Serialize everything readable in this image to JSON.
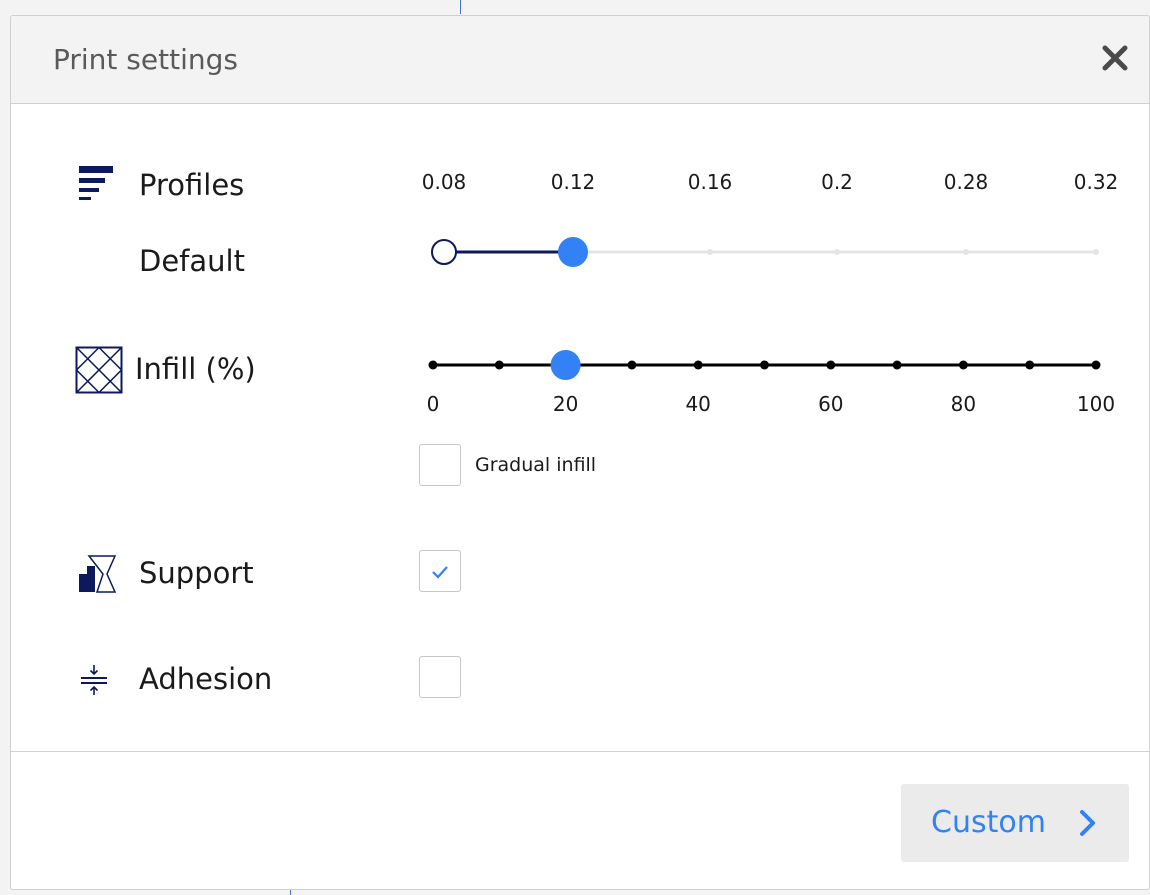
{
  "panel": {
    "title": "Print settings",
    "close_glyph": "✕"
  },
  "profiles": {
    "label": "Profiles",
    "current_profile": "Default",
    "icon": "profiles-icon",
    "layer_heights": [
      "0.08",
      "0.12",
      "0.16",
      "0.2",
      "0.28",
      "0.32"
    ],
    "selected_index": 1,
    "min_marker_index": 0
  },
  "infill": {
    "label": "Infill (%)",
    "icon": "infill-icon",
    "tick_labels": [
      "0",
      "20",
      "40",
      "60",
      "80",
      "100"
    ],
    "value": 20,
    "gradual_label": "Gradual infill",
    "gradual_checked": false
  },
  "support": {
    "label": "Support",
    "icon": "support-icon",
    "checked": true
  },
  "adhesion": {
    "label": "Adhesion",
    "icon": "adhesion-icon",
    "checked": false
  },
  "footer": {
    "custom_label": "Custom",
    "chevron_icon": "chevron-right-icon"
  },
  "colors": {
    "accent": "#3282f6",
    "navy": "#0c1a5c",
    "track_dark": "#000000",
    "track_light": "#e4e4e4"
  }
}
